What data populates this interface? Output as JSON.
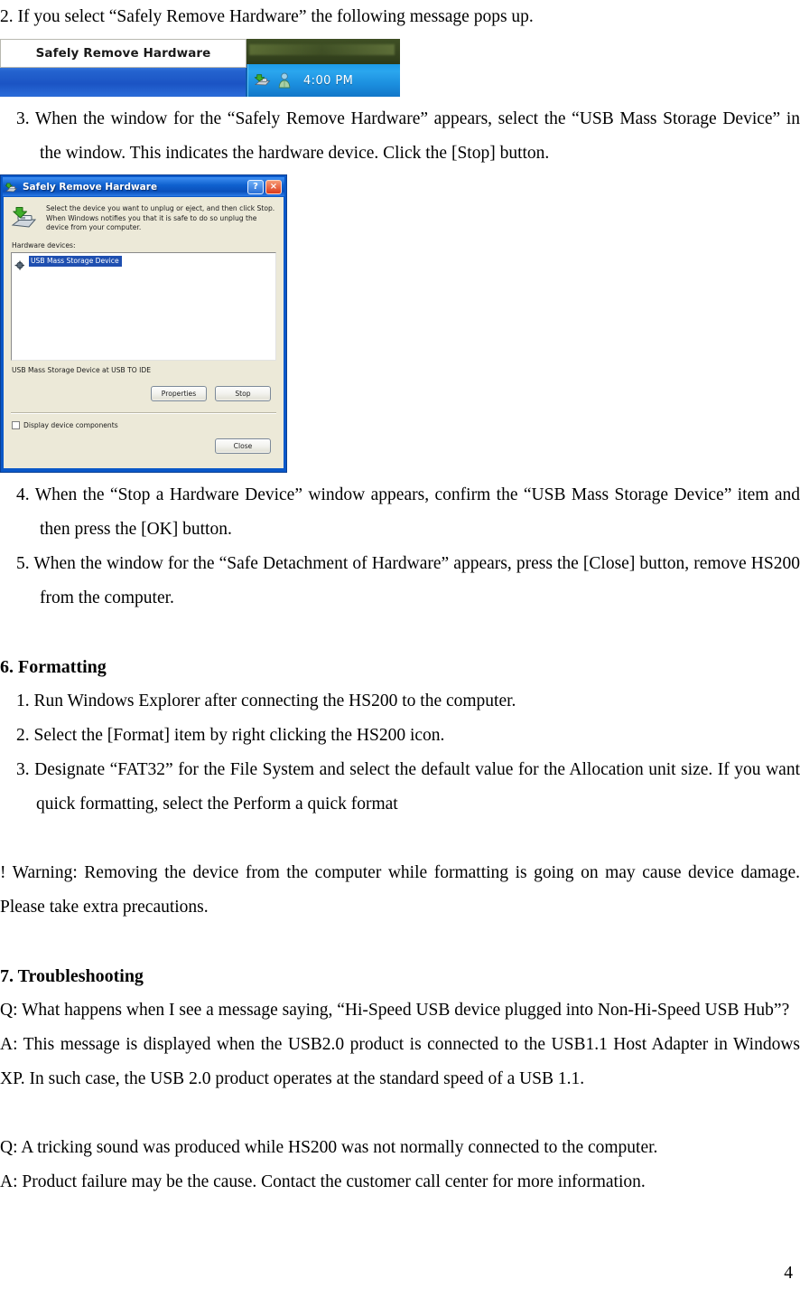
{
  "document": {
    "page_number": "4",
    "blocks": [
      {
        "kind": "paragraph",
        "style": "indent0",
        "text": "2. If you select “Safely Remove Hardware” the following message pops up."
      },
      {
        "kind": "image-taskbar"
      },
      {
        "kind": "paragraph",
        "style": "indent2",
        "text": "3. When the window for the “Safely Remove Hardware” appears, select the “USB Mass Storage Device” in the window. This indicates the hardware device. Click the [Stop] button."
      },
      {
        "kind": "image-dialog"
      },
      {
        "kind": "paragraph",
        "style": "indent2",
        "text": "4. When the “Stop a Hardware Device” window appears, confirm the “USB Mass Storage Device” item and then press the [OK] button."
      },
      {
        "kind": "paragraph",
        "style": "indent2",
        "text": "5. When the window for the “Safe Detachment of Hardware” appears, press the [Close] button, remove HS200 from the computer."
      },
      {
        "kind": "spacer"
      },
      {
        "kind": "heading",
        "text": "6. Formatting"
      },
      {
        "kind": "paragraph",
        "style": "indent1",
        "text": "1. Run Windows Explorer after connecting the HS200 to the computer."
      },
      {
        "kind": "paragraph",
        "style": "indent1",
        "text": "2. Select the [Format] item by right clicking the HS200 icon."
      },
      {
        "kind": "paragraph",
        "style": "indent3",
        "text": "3. Designate “FAT32” for the File System and select the default value for the Allocation unit size. If you want quick formatting, select the Perform a quick format"
      },
      {
        "kind": "spacer"
      },
      {
        "kind": "paragraph",
        "style": "indent0",
        "text": "! Warning: Removing the device from the computer while formatting is going on may cause device damage. Please take extra precautions."
      },
      {
        "kind": "spacer"
      },
      {
        "kind": "heading",
        "text": "7. Troubleshooting"
      },
      {
        "kind": "paragraph",
        "style": "indent0",
        "text": "Q: What happens when I see a message saying, “Hi-Speed USB device plugged into Non-Hi-Speed USB Hub”?"
      },
      {
        "kind": "paragraph",
        "style": "indent0",
        "text": "A: This message is displayed when the USB2.0 product is connected to the USB1.1 Host Adapter in Windows XP. In such case, the USB 2.0 product operates at the standard speed of a USB 1.1."
      },
      {
        "kind": "spacer"
      },
      {
        "kind": "paragraph",
        "style": "indent0-nojust",
        "text": "Q: A tricking sound was produced while HS200 was not normally connected to the computer."
      },
      {
        "kind": "paragraph",
        "style": "indent0-nojust",
        "text": "A: Product failure may be the cause. Contact the customer call center for more information."
      }
    ]
  },
  "taskbar_screenshot": {
    "tooltip_text": "Safely Remove Hardware",
    "clock": "4:00 PM",
    "tray_icons": [
      "safely-remove-hardware-icon",
      "user-account-icon"
    ],
    "colors": {
      "taskbar_blue": "#1b54c4",
      "tray_blue": "#1b8ede",
      "tooltip_background": "#ffffff",
      "desktop_green": "#36441f"
    }
  },
  "dialog_screenshot": {
    "title": "Safely Remove Hardware",
    "titlebar_buttons": [
      "?",
      "×"
    ],
    "intro_text": "Select the device you want to unplug or eject, and then click Stop. When Windows notifies you that it is safe to do so unplug the device from your computer.",
    "devices_label": "Hardware devices:",
    "device_items": [
      "USB Mass Storage Device"
    ],
    "status_text": "USB Mass Storage Device at USB TO IDE",
    "buttons": {
      "properties": "Properties",
      "stop": "Stop",
      "close": "Close"
    },
    "checkbox_label": "Display device components",
    "checkbox_checked": false,
    "colors": {
      "titlebar_blue": "#0f61cf",
      "dialog_face": "#ece9d8",
      "selection_blue": "#1f4fb0",
      "close_red": "#dc3a1a"
    }
  }
}
